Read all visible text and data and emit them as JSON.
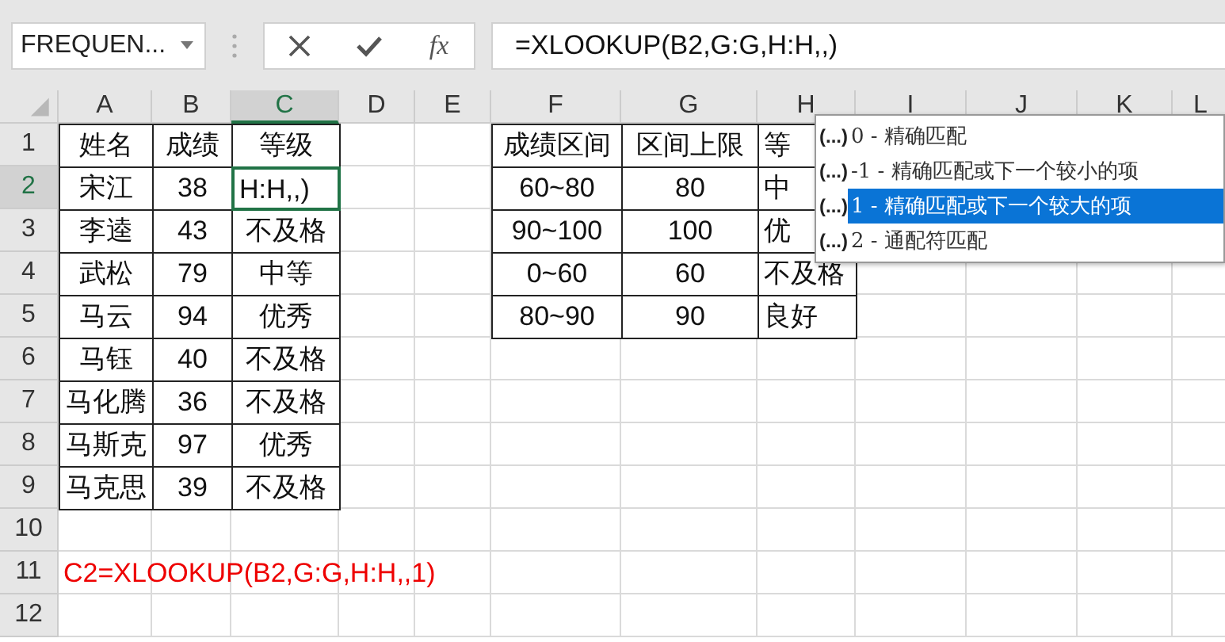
{
  "name_box": {
    "value": "FREQUEN..."
  },
  "fx_label": "fx",
  "formula": "=XLOOKUP(B2,G:G,H:H,,)",
  "columns": [
    {
      "label": "A",
      "selected": false
    },
    {
      "label": "B",
      "selected": false
    },
    {
      "label": "C",
      "selected": true
    },
    {
      "label": "D",
      "selected": false
    },
    {
      "label": "E",
      "selected": false
    },
    {
      "label": "F",
      "selected": false
    },
    {
      "label": "G",
      "selected": false
    },
    {
      "label": "H",
      "selected": false
    },
    {
      "label": "I",
      "selected": false
    },
    {
      "label": "J",
      "selected": false
    },
    {
      "label": "K",
      "selected": false
    },
    {
      "label": "L",
      "selected": false
    }
  ],
  "row_headers": [
    {
      "label": "1",
      "selected": false
    },
    {
      "label": "2",
      "selected": true
    },
    {
      "label": "3",
      "selected": false
    },
    {
      "label": "4",
      "selected": false
    },
    {
      "label": "5",
      "selected": false
    },
    {
      "label": "6",
      "selected": false
    },
    {
      "label": "7",
      "selected": false
    },
    {
      "label": "8",
      "selected": false
    },
    {
      "label": "9",
      "selected": false
    },
    {
      "label": "10",
      "selected": false
    },
    {
      "label": "11",
      "selected": false
    },
    {
      "label": "12",
      "selected": false
    }
  ],
  "tables": [
    {
      "rows": [
        [
          {
            "text": "姓名",
            "selected": false
          },
          {
            "text": "成绩",
            "selected": false
          },
          {
            "text": "等级",
            "selected": false
          }
        ],
        [
          {
            "text": "宋江",
            "selected": false
          },
          {
            "text": "38",
            "selected": false
          },
          {
            "text": "H:H,,)",
            "selected": true
          }
        ],
        [
          {
            "text": "李逵",
            "selected": false
          },
          {
            "text": "43",
            "selected": false
          },
          {
            "text": "不及格",
            "selected": false
          }
        ],
        [
          {
            "text": "武松",
            "selected": false
          },
          {
            "text": "79",
            "selected": false
          },
          {
            "text": "中等",
            "selected": false
          }
        ],
        [
          {
            "text": "马云",
            "selected": false
          },
          {
            "text": "94",
            "selected": false
          },
          {
            "text": "优秀",
            "selected": false
          }
        ],
        [
          {
            "text": "马钰",
            "selected": false
          },
          {
            "text": "40",
            "selected": false
          },
          {
            "text": "不及格",
            "selected": false
          }
        ],
        [
          {
            "text": "马化腾",
            "selected": false
          },
          {
            "text": "36",
            "selected": false
          },
          {
            "text": "不及格",
            "selected": false
          }
        ],
        [
          {
            "text": "马斯克",
            "selected": false
          },
          {
            "text": "97",
            "selected": false
          },
          {
            "text": "优秀",
            "selected": false
          }
        ],
        [
          {
            "text": "马克思",
            "selected": false
          },
          {
            "text": "39",
            "selected": false
          },
          {
            "text": "不及格",
            "selected": false
          }
        ]
      ]
    },
    {
      "rows": [
        [
          {
            "text": "成绩区间",
            "selected": false
          },
          {
            "text": "区间上限",
            "selected": false
          },
          {
            "text": "等",
            "selected": false
          }
        ],
        [
          {
            "text": "60~80",
            "selected": false
          },
          {
            "text": "80",
            "selected": false
          },
          {
            "text": "中",
            "selected": false
          }
        ],
        [
          {
            "text": "90~100",
            "selected": false
          },
          {
            "text": "100",
            "selected": false
          },
          {
            "text": "优",
            "selected": false
          }
        ],
        [
          {
            "text": "0~60",
            "selected": false
          },
          {
            "text": "60",
            "selected": false
          },
          {
            "text": "不及格",
            "selected": false
          }
        ],
        [
          {
            "text": "80~90",
            "selected": false
          },
          {
            "text": "90",
            "selected": false
          },
          {
            "text": "良好",
            "selected": false
          }
        ]
      ]
    }
  ],
  "note": {
    "text": "C2=XLOOKUP(B2,G:G,H:H,,1)"
  },
  "autocomplete": {
    "items": [
      {
        "prefix": "(...)",
        "label": "0 - 精确匹配",
        "selected": false
      },
      {
        "prefix": "(...)",
        "label": "-1 - 精确匹配或下一个较小的项",
        "selected": false
      },
      {
        "prefix": "(...)",
        "label": "1 - 精确匹配或下一个较大的项",
        "selected": true
      },
      {
        "prefix": "(...)",
        "label": "2 - 通配符匹配",
        "selected": false
      }
    ]
  }
}
